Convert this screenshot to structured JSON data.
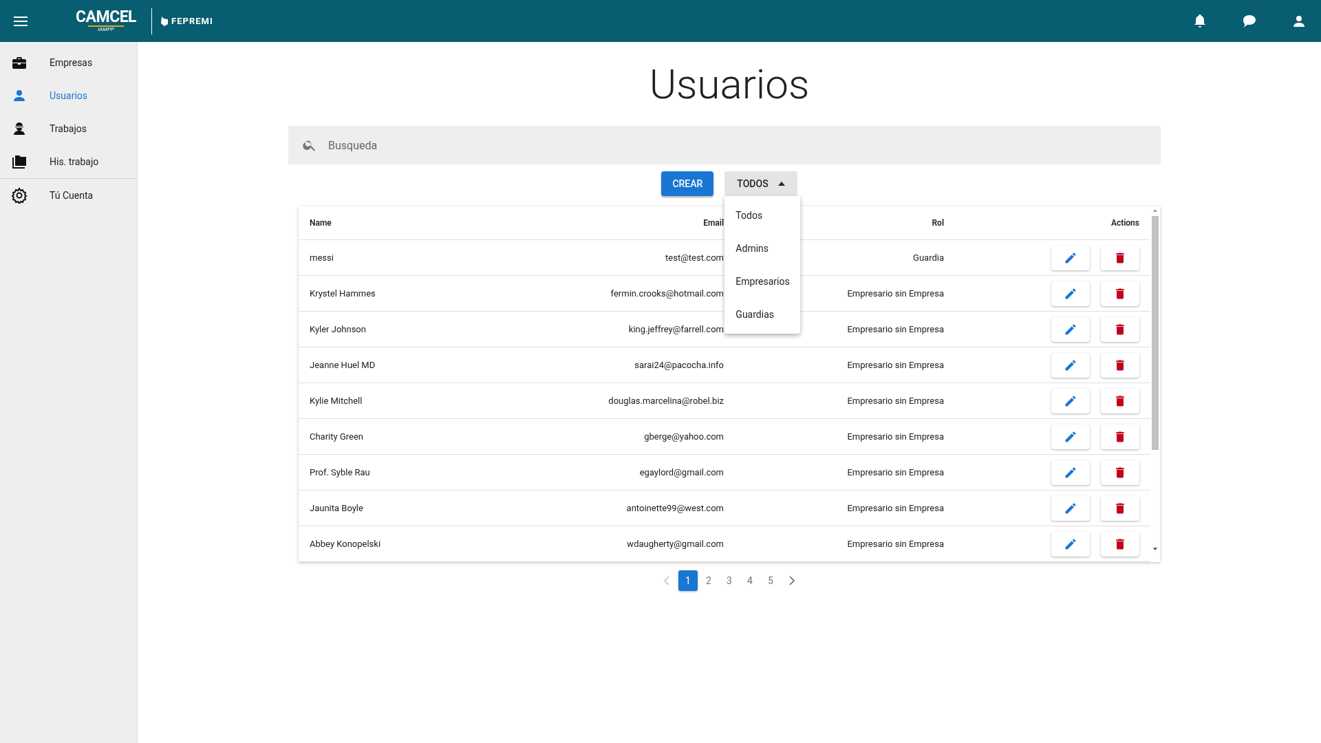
{
  "header": {
    "logo": {
      "name": "CAMCEL",
      "sub": "IAMPP"
    },
    "partner_logo": "FEPREMI"
  },
  "sidebar": {
    "items": [
      {
        "label": "Empresas",
        "kind": "briefcase",
        "selected": false
      },
      {
        "label": "Usuarios",
        "kind": "person",
        "selected": true
      },
      {
        "label": "Trabajos",
        "kind": "worker",
        "selected": false
      },
      {
        "label": "His. trabajo",
        "kind": "folders",
        "selected": false
      },
      {
        "label": "Tú Cuenta",
        "kind": "gear",
        "selected": false,
        "divider_before": true
      }
    ]
  },
  "page": {
    "title": "Usuarios"
  },
  "search": {
    "placeholder": "Busqueda"
  },
  "create_button": "CREAR",
  "filter": {
    "label": "TODOS",
    "expanded": true,
    "options": [
      {
        "label": "Todos"
      },
      {
        "label": "Admins"
      },
      {
        "label": "Empresarios"
      },
      {
        "label": "Guardias"
      }
    ]
  },
  "table": {
    "columns": [
      "Name",
      "Email",
      "Rol",
      "Actions"
    ],
    "rows": [
      {
        "name": "messi",
        "email": "test@test.com",
        "rol": "Guardia"
      },
      {
        "name": "Krystel Hammes",
        "email": "fermin.crooks@hotmail.com",
        "rol": "Empresario sin Empresa"
      },
      {
        "name": "Kyler Johnson",
        "email": "king.jeffrey@farrell.com",
        "rol": "Empresario sin Empresa"
      },
      {
        "name": "Jeanne Huel MD",
        "email": "sarai24@pacocha.info",
        "rol": "Empresario sin Empresa"
      },
      {
        "name": "Kylie Mitchell",
        "email": "douglas.marcelina@robel.biz",
        "rol": "Empresario sin Empresa"
      },
      {
        "name": "Charity Green",
        "email": "gberge@yahoo.com",
        "rol": "Empresario sin Empresa"
      },
      {
        "name": "Prof. Syble Rau",
        "email": "egaylord@gmail.com",
        "rol": "Empresario sin Empresa"
      },
      {
        "name": "Jaunita Boyle",
        "email": "antoinette99@west.com",
        "rol": "Empresario sin Empresa"
      },
      {
        "name": "Abbey Konopelski",
        "email": "wdaugherty@gmail.com",
        "rol": "Empresario sin Empresa"
      }
    ]
  },
  "pagination": {
    "prev_disabled": true,
    "pages": [
      {
        "label": "1",
        "selected": true
      },
      {
        "label": "2",
        "selected": false
      },
      {
        "label": "3",
        "selected": false
      },
      {
        "label": "4",
        "selected": false
      },
      {
        "label": "5",
        "selected": false
      }
    ]
  }
}
